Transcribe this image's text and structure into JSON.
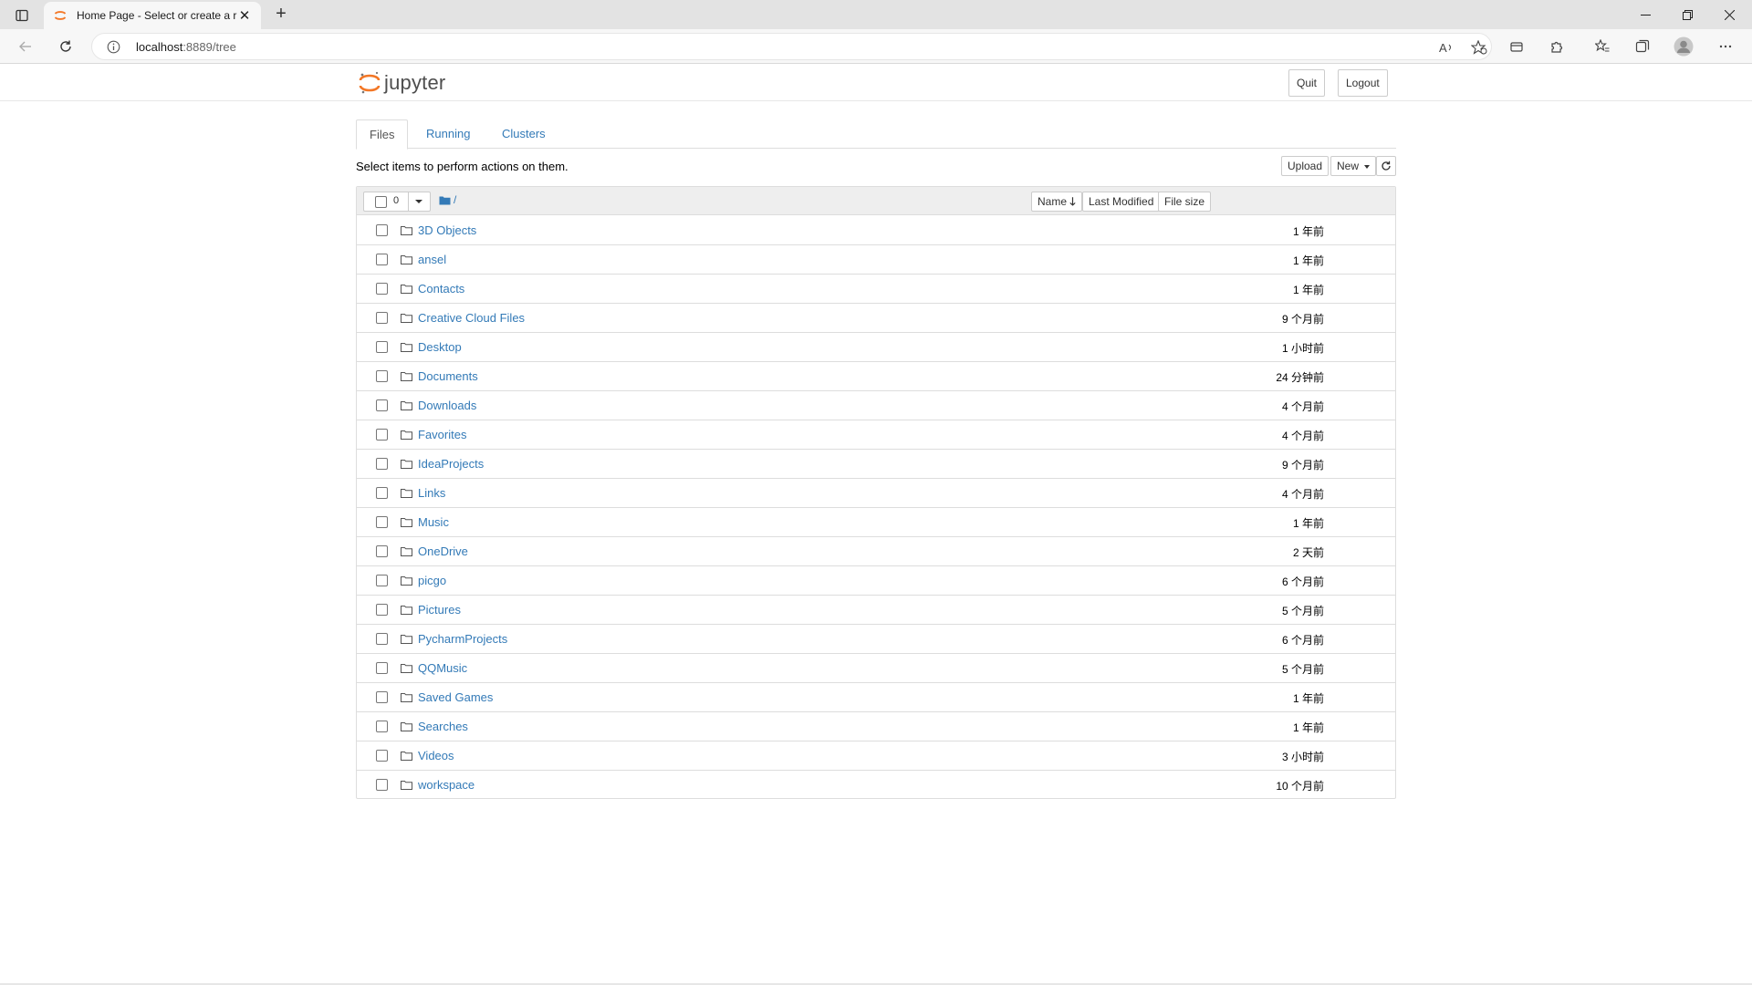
{
  "browser": {
    "tab_title": "Home Page - Select or create a r",
    "new_tab_glyph": "+",
    "close_tab_glyph": "✕",
    "address": {
      "host": "localhost",
      "rest": ":8889/tree"
    },
    "window_controls": {
      "minimize": "─",
      "restore": "❐",
      "close": "✕"
    }
  },
  "app": {
    "logo_text": "jupyter",
    "quit_label": "Quit",
    "logout_label": "Logout",
    "accent_color": "#F37726",
    "link_color": "#337AB7"
  },
  "tabs": [
    {
      "label": "Files",
      "active": true
    },
    {
      "label": "Running",
      "active": false
    },
    {
      "label": "Clusters",
      "active": false
    }
  ],
  "toolbar": {
    "hint": "Select items to perform actions on them.",
    "upload_label": "Upload",
    "new_label": "New",
    "refresh_icon": "refresh-icon"
  },
  "list_header": {
    "selected_count": "0",
    "path": "/",
    "sort_name_label": "Name",
    "last_modified_label": "Last Modified",
    "file_size_label": "File size"
  },
  "files": [
    {
      "name": "3D Objects",
      "modified": "1 年前"
    },
    {
      "name": "ansel",
      "modified": "1 年前"
    },
    {
      "name": "Contacts",
      "modified": "1 年前"
    },
    {
      "name": "Creative Cloud Files",
      "modified": "9 个月前"
    },
    {
      "name": "Desktop",
      "modified": "1 小时前"
    },
    {
      "name": "Documents",
      "modified": "24 分钟前"
    },
    {
      "name": "Downloads",
      "modified": "4 个月前"
    },
    {
      "name": "Favorites",
      "modified": "4 个月前"
    },
    {
      "name": "IdeaProjects",
      "modified": "9 个月前"
    },
    {
      "name": "Links",
      "modified": "4 个月前"
    },
    {
      "name": "Music",
      "modified": "1 年前"
    },
    {
      "name": "OneDrive",
      "modified": "2 天前"
    },
    {
      "name": "picgo",
      "modified": "6 个月前"
    },
    {
      "name": "Pictures",
      "modified": "5 个月前"
    },
    {
      "name": "PycharmProjects",
      "modified": "6 个月前"
    },
    {
      "name": "QQMusic",
      "modified": "5 个月前"
    },
    {
      "name": "Saved Games",
      "modified": "1 年前"
    },
    {
      "name": "Searches",
      "modified": "1 年前"
    },
    {
      "name": "Videos",
      "modified": "3 小时前"
    },
    {
      "name": "workspace",
      "modified": "10 个月前"
    }
  ]
}
